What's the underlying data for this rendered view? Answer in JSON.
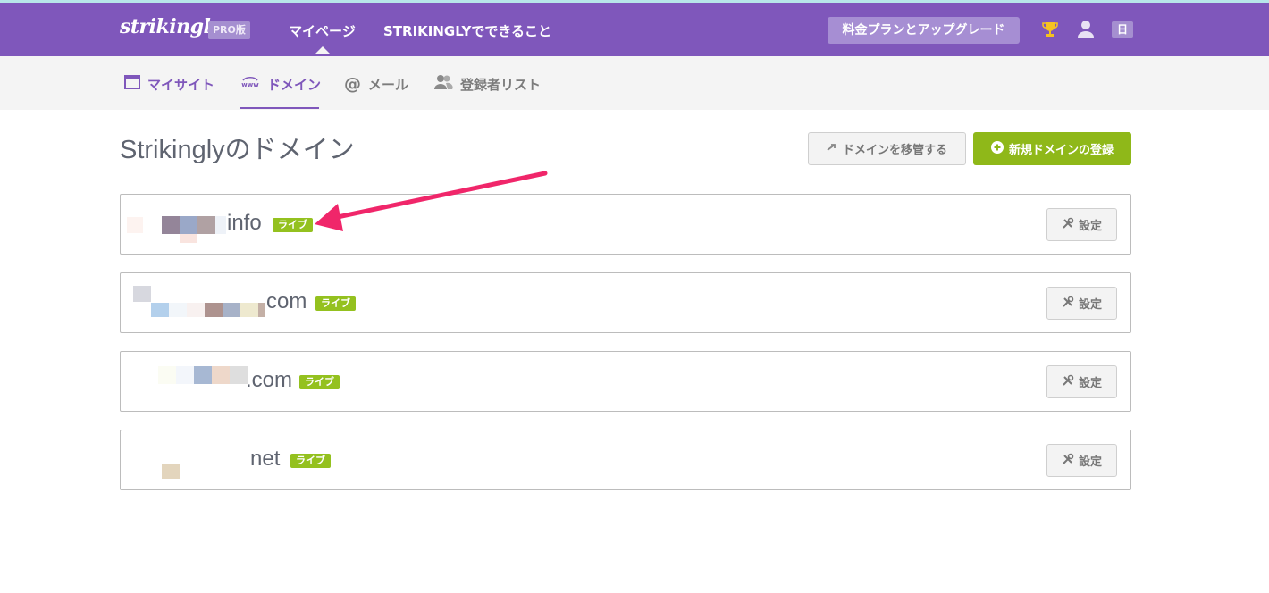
{
  "header": {
    "logo": "strikingly",
    "pro_badge": "PRO版",
    "nav_mypage": "マイページ",
    "nav_features": "STRIKINGLYでできること",
    "upgrade": "料金プランとアップグレード",
    "lang": "日"
  },
  "subnav": {
    "mysite": "マイサイト",
    "domain": "ドメイン",
    "mail": "メール",
    "subscribers": "登録者リスト"
  },
  "page": {
    "title": "Strikinglyのドメイン",
    "transfer_button": "ドメインを移管する",
    "register_button": "新規ドメインの登録"
  },
  "domains": [
    {
      "suffix": "info",
      "status": "ライブ",
      "settings": "設定"
    },
    {
      "suffix": "com",
      "status": "ライブ",
      "settings": "設定"
    },
    {
      "suffix": ".com",
      "status": "ライブ",
      "settings": "設定"
    },
    {
      "suffix": "net",
      "status": "ライブ",
      "settings": "設定"
    }
  ],
  "colors": {
    "brand_purple": "#7f57bb",
    "live_green": "#94c11f",
    "register_green": "#8fb819",
    "annotation_arrow": "#f0266a"
  },
  "icons": {
    "trophy": "trophy-icon",
    "user": "user-icon",
    "mysite": "browser-window-icon",
    "domain": "www-icon",
    "mail": "at-icon",
    "subscribers": "people-icon",
    "transfer": "arrow-right-icon",
    "register": "plus-circle-icon",
    "settings": "tools-icon"
  }
}
